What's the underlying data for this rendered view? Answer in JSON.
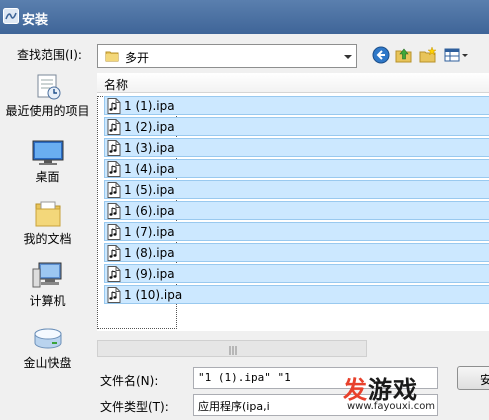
{
  "window": {
    "title": "安装",
    "title_color": "#3f6598"
  },
  "lookin": {
    "label": "查找范围(I):",
    "value": "多开",
    "icon": "folder-icon"
  },
  "toolbar": {
    "icons": [
      "back-icon",
      "up-folder-icon",
      "new-folder-icon",
      "view-menu-icon"
    ]
  },
  "places": [
    {
      "label": "最近使用的项目",
      "icon": "recent-items-icon"
    },
    {
      "label": "桌面",
      "icon": "desktop-icon"
    },
    {
      "label": "我的文档",
      "icon": "documents-icon"
    },
    {
      "label": "计算机",
      "icon": "computer-icon"
    },
    {
      "label": "金山快盘",
      "icon": "drive-icon"
    }
  ],
  "filelist": {
    "column_name": "名称",
    "selection_color": "#cce8ff",
    "files": [
      "1 (1).ipa",
      "1 (2).ipa",
      "1 (3).ipa",
      "1 (4).ipa",
      "1 (5).ipa",
      "1 (6).ipa",
      "1 (7).ipa",
      "1 (8).ipa",
      "1 (9).ipa",
      "1 (10).ipa"
    ]
  },
  "filename": {
    "label": "文件名(N):",
    "value": "\"1 (1).ipa\" \"1"
  },
  "filetype": {
    "label": "文件类型(T):",
    "value": "应用程序(ipa,i"
  },
  "buttons": {
    "ok_label": "安"
  },
  "watermark": {
    "accent_text": "发",
    "main_text": "游戏",
    "url": "www.fayouxi.com",
    "accent_color": "#e8412c"
  }
}
